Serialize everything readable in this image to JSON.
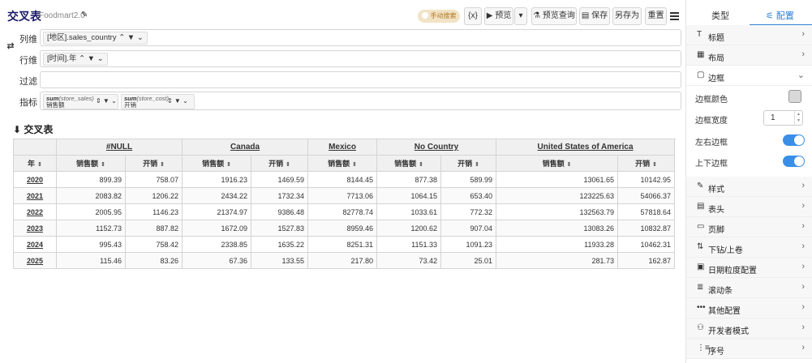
{
  "header": {
    "title": "交叉表",
    "subtitle": "Foodmart2.0",
    "mode_label": "手动搜索",
    "var_label": "{x}",
    "preview_label": "预览",
    "preview_query_label": "预览查询",
    "save_label": "保存",
    "save_as_label": "另存为",
    "reset_label": "重置"
  },
  "config_rows": {
    "columns_label": "列维",
    "rows_label": "行维",
    "filter_label": "过滤",
    "measures_label": "指标",
    "column_tag": "[地区].sales_country",
    "row_tag": "[时间].年",
    "measures": [
      {
        "func": "sum",
        "field": "(store_sales)",
        "alias": "销售额"
      },
      {
        "func": "sum",
        "field": "(store_cost)",
        "alias": "开销"
      }
    ]
  },
  "section": {
    "title": "交叉表"
  },
  "table": {
    "corner_label": "年",
    "countries": [
      "#NULL",
      "Canada",
      "Mexico",
      "No Country",
      "United States of America"
    ],
    "sub_headers": [
      "销售额",
      "开销"
    ],
    "rows": [
      {
        "year": "2020",
        "cells": [
          "899.39",
          "758.07",
          "1916.23",
          "1469.59",
          "8144.45",
          "877.38",
          "589.99",
          "13061.65",
          "10142.95"
        ]
      },
      {
        "year": "2021",
        "cells": [
          "2083.82",
          "1206.22",
          "2434.22",
          "1732.34",
          "7713.06",
          "1064.15",
          "653.40",
          "123225.63",
          "54066.37"
        ]
      },
      {
        "year": "2022",
        "cells": [
          "2005.95",
          "1146.23",
          "21374.97",
          "9386.48",
          "82778.74",
          "1033.61",
          "772.32",
          "132563.79",
          "57818.64"
        ]
      },
      {
        "year": "2023",
        "cells": [
          "1152.73",
          "887.82",
          "1672.09",
          "1527.83",
          "8959.46",
          "1200.62",
          "907.04",
          "13083.26",
          "10832.87"
        ]
      },
      {
        "year": "2024",
        "cells": [
          "995.43",
          "758.42",
          "2338.85",
          "1635.22",
          "8251.31",
          "1151.33",
          "1091.23",
          "11933.28",
          "10462.31"
        ]
      },
      {
        "year": "2025",
        "cells": [
          "115.46",
          "83.26",
          "67.36",
          "133.55",
          "217.80",
          "73.42",
          "25.01",
          "281.73",
          "162.87"
        ]
      }
    ]
  },
  "panel": {
    "tab_type": "类型",
    "tab_config": "配置",
    "items_top": [
      {
        "icon": "title-icon",
        "glyph": "T",
        "label": "标题"
      },
      {
        "icon": "layout-icon",
        "glyph": "▦",
        "label": "布局"
      }
    ],
    "border_section": {
      "icon": "border-icon",
      "glyph": "▢",
      "label": "边框"
    },
    "border_color_label": "边框颜色",
    "border_width_label": "边框宽度",
    "border_width_value": "1",
    "lr_border_label": "左右边框",
    "tb_border_label": "上下边框",
    "items_bottom": [
      {
        "icon": "brush-icon",
        "glyph": "✎",
        "label": "样式"
      },
      {
        "icon": "table-header-icon",
        "glyph": "▤",
        "label": "表头"
      },
      {
        "icon": "footer-icon",
        "glyph": "▭",
        "label": "页脚"
      },
      {
        "icon": "drill-icon",
        "glyph": "⇅",
        "label": "下钻/上卷"
      },
      {
        "icon": "calendar-icon",
        "glyph": "▣",
        "label": "日期粒度配置"
      },
      {
        "icon": "scrollbar-icon",
        "glyph": "≣",
        "label": "滚动条"
      },
      {
        "icon": "more-icon",
        "glyph": "•••",
        "label": "其他配置"
      },
      {
        "icon": "developer-icon",
        "glyph": "⚇",
        "label": "开发者模式"
      },
      {
        "icon": "serial-icon",
        "glyph": "⋮≡",
        "label": "序号"
      }
    ]
  }
}
